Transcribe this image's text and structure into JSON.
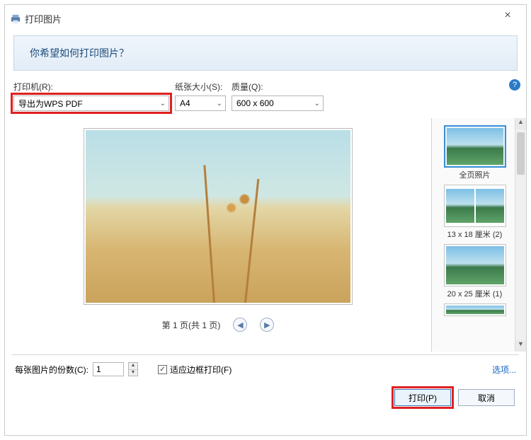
{
  "window": {
    "title": "打印图片",
    "close": "×"
  },
  "banner": {
    "question": "你希望如何打印图片？"
  },
  "labels": {
    "printer": "打印机(R):",
    "paper_size": "纸张大小(S):",
    "quality": "质量(Q):"
  },
  "selectors": {
    "printer_value": "导出为WPS PDF",
    "paper_value": "A4",
    "quality_value": "600 x 600"
  },
  "help": "?",
  "pager": {
    "text": "第 1 页(共 1 页)",
    "prev": "◀",
    "next": "▶"
  },
  "layouts": [
    {
      "caption": "全页照片",
      "cols": 1,
      "selected": true
    },
    {
      "caption": "13 x 18 厘米 (2)",
      "cols": 2,
      "selected": false
    },
    {
      "caption": "20 x 25 厘米 (1)",
      "cols": 1,
      "selected": false
    }
  ],
  "bottom": {
    "copies_label": "每张图片的份数(C):",
    "copies_value": "1",
    "fit_label": "适应边框打印(F)",
    "fit_checked": "✓",
    "options_link": "选项..."
  },
  "actions": {
    "print": "打印(P)",
    "cancel": "取消"
  },
  "scroll": {
    "up": "▲",
    "down": "▼"
  }
}
